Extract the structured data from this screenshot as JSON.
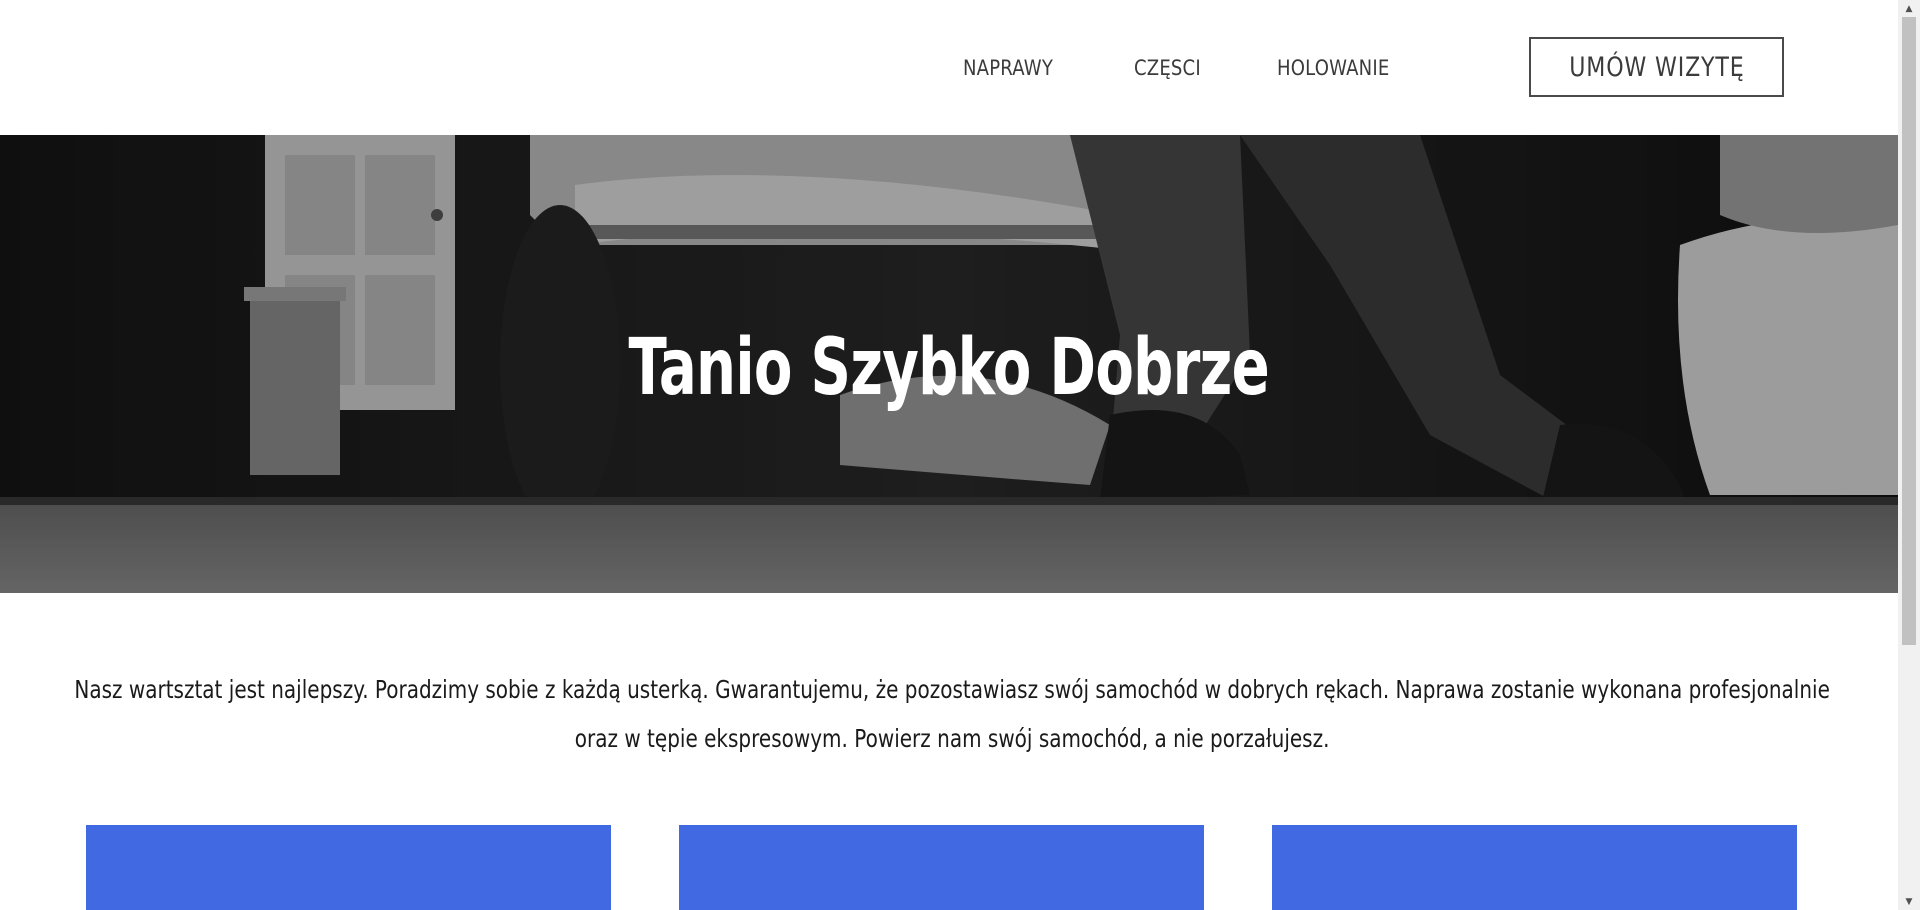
{
  "header": {
    "nav": [
      {
        "label": "NAPRAWY"
      },
      {
        "label": "CZĘSCI"
      },
      {
        "label": "HOLOWANIE"
      }
    ],
    "cta_label": "UMÓW WIZYTĘ"
  },
  "hero": {
    "title": "Tanio Szybko Dobrze"
  },
  "intro": {
    "text": "Nasz wartsztat jest najlepszy. Poradzimy sobie z każdą usterką. Gwarantujemu, że pozostawiasz swój samochód w dobrych rękach. Naprawa zostanie wykonana profesjonalnie oraz w tępie ekspresowym. Powierz nam swój samochód, a nie porzałujesz."
  },
  "colors": {
    "card": "#4169e1",
    "hero_overlay": "#1f1f1f"
  },
  "icons": {
    "scroll_up": "chevron-up-icon",
    "scroll_down": "chevron-down-icon"
  }
}
